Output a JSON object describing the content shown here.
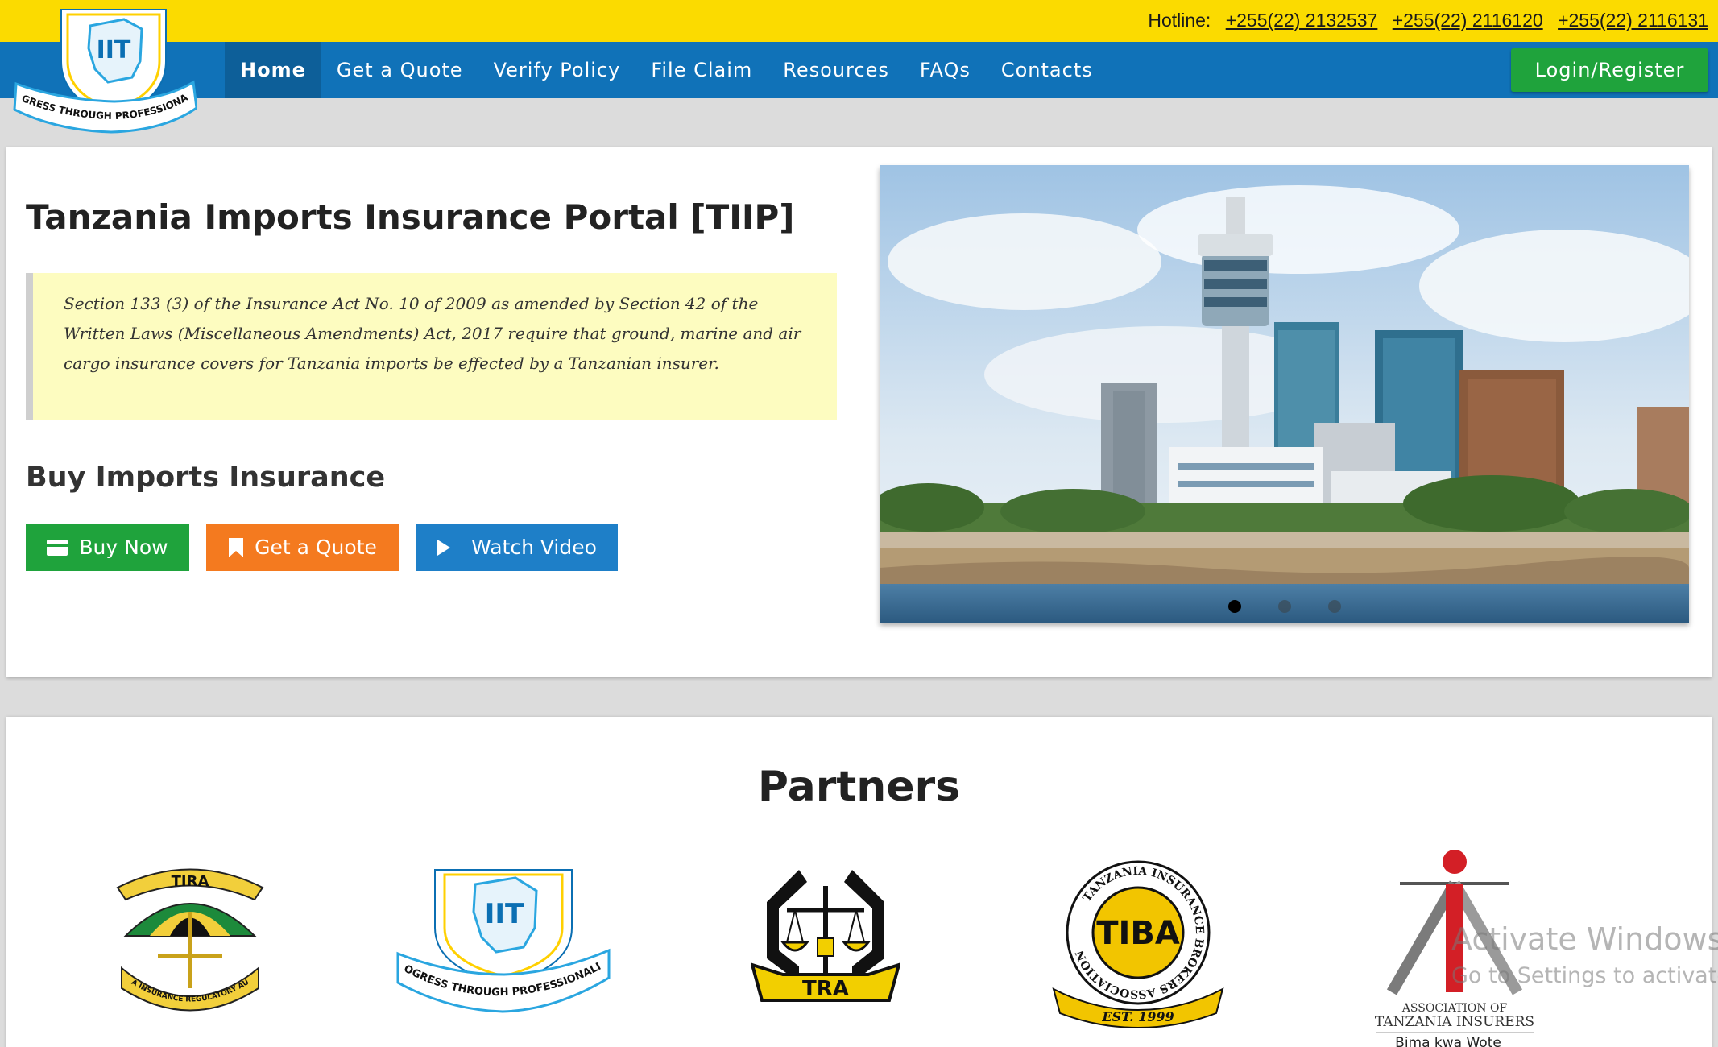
{
  "hotline": {
    "label": "Hotline:",
    "numbers": [
      "+255(22) 2132537",
      "+255(22) 2116120",
      "+255(22) 2116131"
    ]
  },
  "logo": {
    "text": "IIT",
    "motto": "PROGRESS THROUGH PROFESSIONALISM"
  },
  "nav": {
    "items": [
      "Home",
      "Get a Quote",
      "Verify Policy",
      "File Claim",
      "Resources",
      "FAQs",
      "Contacts"
    ],
    "active": "Home",
    "login_label": "Login/Register"
  },
  "hero": {
    "title": "Tanzania Imports Insurance Portal [TIIP]",
    "notice": "Section 133 (3) of the Insurance Act No. 10 of 2009 as amended by Section 42 of the Written Laws (Miscellaneous Amendments) Act, 2017 require that ground, marine and air cargo insurance covers for Tanzania imports be effected by a Tanzanian insurer.",
    "buy_heading": "Buy Imports Insurance",
    "buttons": {
      "buy": "Buy Now",
      "quote": "Get a Quote",
      "video": "Watch Video"
    },
    "slides": {
      "count": 3,
      "active_index": 0
    }
  },
  "partners": {
    "title": "Partners",
    "logos": [
      {
        "name": "TIRA",
        "caption": "TANZANIA INSURANCE REGULATORY AUTHORITY"
      },
      {
        "name": "IIT",
        "caption": "PROGRESS THROUGH PROFESSIONALISM"
      },
      {
        "name": "TRA",
        "caption": "TRA"
      },
      {
        "name": "TIBA",
        "ring": "TANZANIA INSURANCE BROKERS ASSOCIATION",
        "est": "EST. 1999"
      },
      {
        "name": "ATI",
        "line1": "ASSOCIATION OF",
        "line2": "TANZANIA INSURERS",
        "tagline": "Bima kwa Wote"
      }
    ]
  },
  "watermark": {
    "line1": "Activate Windows",
    "line2": "Go to Settings to activate"
  },
  "colors": {
    "topbar": "#fbdb00",
    "navbar": "#1072b8",
    "green": "#1fa33c",
    "orange": "#f47a1f",
    "blue": "#1e7fc8",
    "notice_bg": "#fdfcc0"
  }
}
